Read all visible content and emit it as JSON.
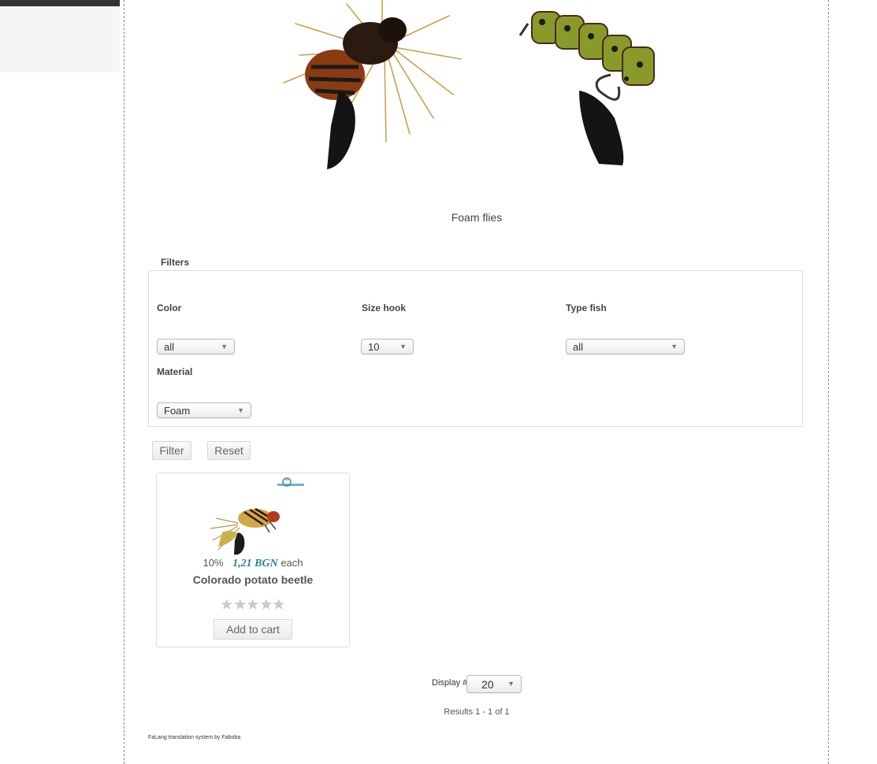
{
  "category": {
    "title": "Foam flies"
  },
  "filters": {
    "legend": "Filters",
    "color": {
      "label": "Color",
      "value": "all"
    },
    "size_hook": {
      "label": "Size hook",
      "value": "10"
    },
    "type_fish": {
      "label": "Type fish",
      "value": "all"
    },
    "material": {
      "label": "Material",
      "value": "Foam"
    },
    "filter_label": "Filter",
    "reset_label": "Reset"
  },
  "product": {
    "discount": "10%",
    "price": "1,21 BGN",
    "price_suffix": "each",
    "name": "Colorado potato beetle",
    "rating": 0,
    "add_to_cart_label": "Add to cart"
  },
  "pagination": {
    "display_label": "Display #",
    "display_value": "20",
    "results_text": "Results 1 - 1 of 1"
  },
  "footer": {
    "credit": "FaLang translation system by Faboba"
  },
  "colors": {
    "price": "#2b7f9c",
    "border": "#dcdcdc",
    "top_bar": "#333333"
  },
  "icons": {
    "select_arrow": "triangle-down-icon",
    "rating_star": "star-icon"
  }
}
